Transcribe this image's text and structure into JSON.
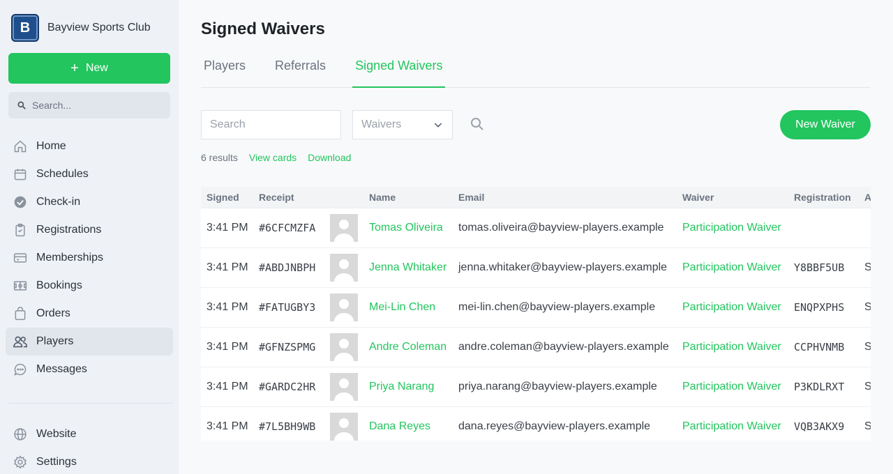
{
  "brand": {
    "logo_letter": "B",
    "name": "Bayview Sports Club"
  },
  "sidebar": {
    "new_label": "New",
    "search_placeholder": "Search...",
    "items": [
      {
        "label": "Home",
        "icon": "home-icon"
      },
      {
        "label": "Schedules",
        "icon": "calendar-icon"
      },
      {
        "label": "Check-in",
        "icon": "check-circle-icon"
      },
      {
        "label": "Registrations",
        "icon": "clipboard-icon"
      },
      {
        "label": "Memberships",
        "icon": "card-icon"
      },
      {
        "label": "Bookings",
        "icon": "field-icon"
      },
      {
        "label": "Orders",
        "icon": "bag-icon"
      },
      {
        "label": "Players",
        "icon": "users-icon",
        "active": true
      },
      {
        "label": "Messages",
        "icon": "chat-icon"
      }
    ],
    "bottom_items": [
      {
        "label": "Website",
        "icon": "globe-icon"
      },
      {
        "label": "Settings",
        "icon": "gear-icon"
      }
    ]
  },
  "page": {
    "title": "Signed Waivers",
    "tabs": [
      {
        "label": "Players"
      },
      {
        "label": "Referrals"
      },
      {
        "label": "Signed Waivers",
        "active": true
      }
    ]
  },
  "toolbar": {
    "search_placeholder": "Search",
    "filter_value": "Waivers",
    "new_waiver_label": "New Waiver"
  },
  "meta": {
    "count": "6 results",
    "view_cards": "View cards",
    "download": "Download"
  },
  "table": {
    "columns": [
      "Signed",
      "Receipt",
      "",
      "Name",
      "Email",
      "Waiver",
      "Registration",
      "A"
    ],
    "rows": [
      {
        "signed": "3:41 PM",
        "receipt": "#6CFCMZFA",
        "name": "Tomas Oliveira",
        "email": "tomas.oliveira@bayview-players.example",
        "waiver": "Participation Waiver",
        "registration": "",
        "extra": ""
      },
      {
        "signed": "3:41 PM",
        "receipt": "#ABDJNBPH",
        "name": "Jenna Whitaker",
        "email": "jenna.whitaker@bayview-players.example",
        "waiver": "Participation Waiver",
        "registration": "Y8BBF5UB",
        "extra": "S"
      },
      {
        "signed": "3:41 PM",
        "receipt": "#FATUGBY3",
        "name": "Mei-Lin Chen",
        "email": "mei-lin.chen@bayview-players.example",
        "waiver": "Participation Waiver",
        "registration": "ENQPXPHS",
        "extra": "S"
      },
      {
        "signed": "3:41 PM",
        "receipt": "#GFNZSPMG",
        "name": "Andre Coleman",
        "email": "andre.coleman@bayview-players.example",
        "waiver": "Participation Waiver",
        "registration": "CCPHVNMB",
        "extra": "S"
      },
      {
        "signed": "3:41 PM",
        "receipt": "#GARDC2HR",
        "name": "Priya Narang",
        "email": "priya.narang@bayview-players.example",
        "waiver": "Participation Waiver",
        "registration": "P3KDLRXT",
        "extra": "S"
      },
      {
        "signed": "3:41 PM",
        "receipt": "#7L5BH9WB",
        "name": "Dana Reyes",
        "email": "dana.reyes@bayview-players.example",
        "waiver": "Participation Waiver",
        "registration": "VQB3AKX9",
        "extra": "S"
      }
    ]
  },
  "colors": {
    "accent": "#22c55e",
    "brand": "#1f4e8c",
    "sidebar_bg": "#eef2f7"
  }
}
